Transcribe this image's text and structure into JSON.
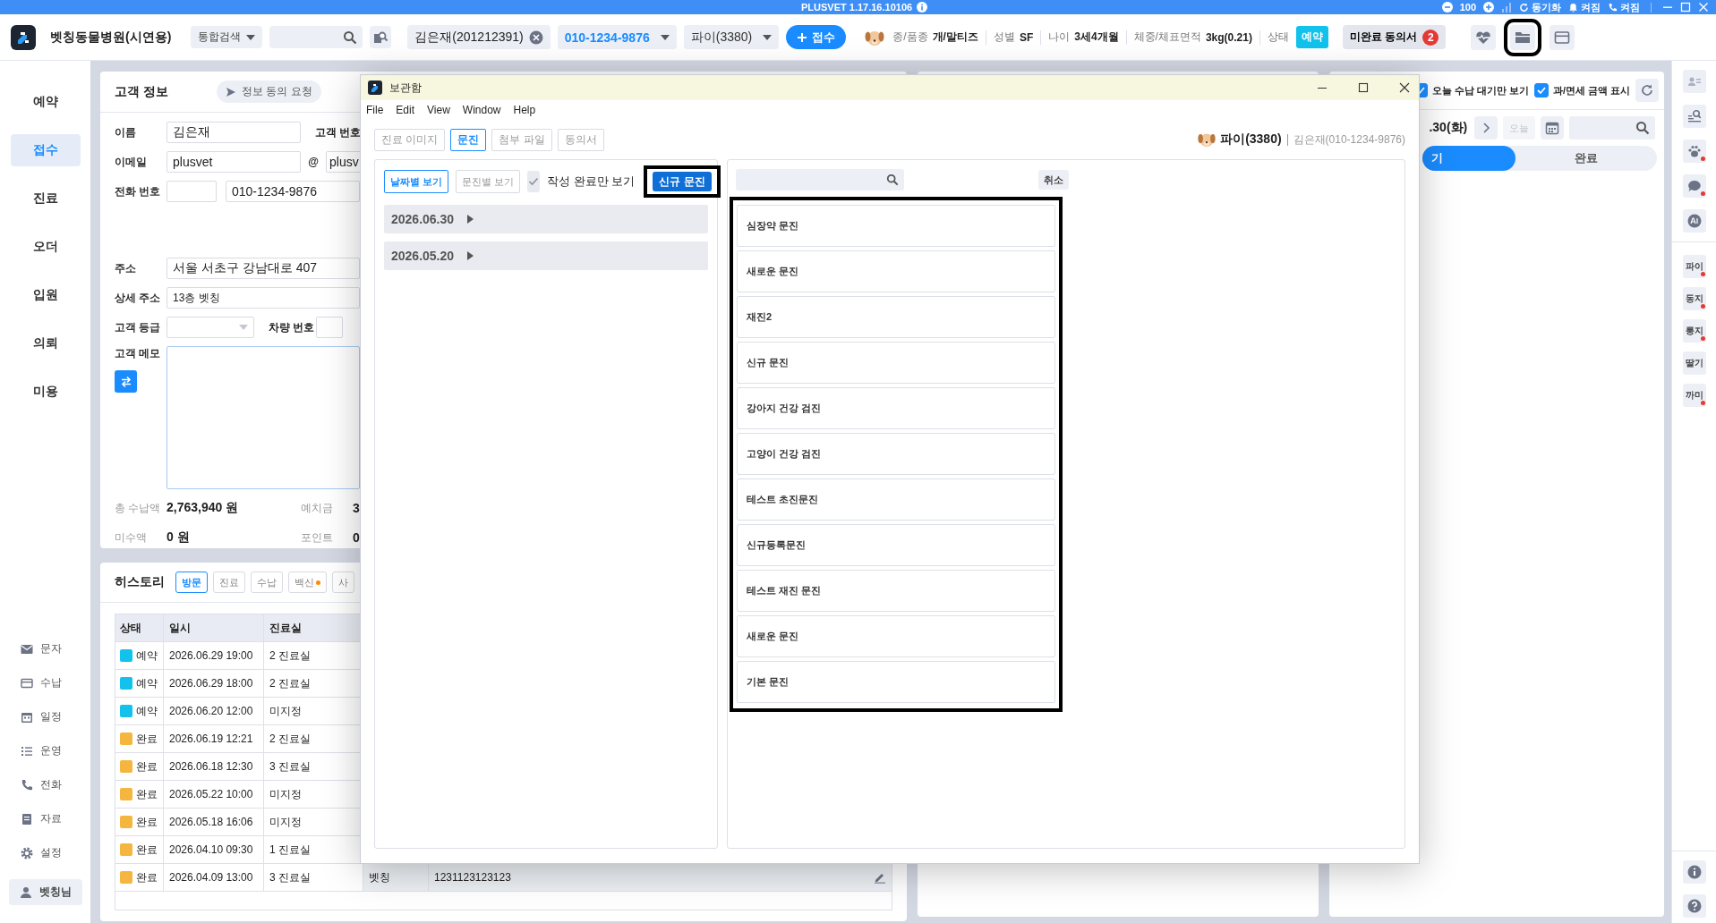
{
  "app_bar": {
    "title": "PLUSVET 1.17.16.10106",
    "zoom": "100",
    "sync": "동기화",
    "alarm": "켜짐",
    "phone": "켜짐"
  },
  "header": {
    "clinic": "벳칭동물병원(시연용)",
    "search_scope": "통합검색",
    "customer_chip": "김은재(201212391)",
    "phone": "010-1234-9876",
    "pet": "파이(3380)",
    "register_button": "접수",
    "pet_info": [
      {
        "label": "종/품종",
        "value": "개/말티즈"
      },
      {
        "label": "성별",
        "value": "SF"
      },
      {
        "label": "나이",
        "value": "3세4개월"
      },
      {
        "label": "체중/체표면적",
        "value": "3kg(0.21)"
      }
    ],
    "status_label": "상태",
    "status": "예약",
    "consent": "미완료 동의서",
    "consent_count": "2"
  },
  "nav": {
    "items": [
      {
        "label": "예약",
        "selected": false
      },
      {
        "label": "접수",
        "selected": true
      },
      {
        "label": "진료",
        "selected": false
      },
      {
        "label": "오더",
        "selected": false
      },
      {
        "label": "입원",
        "selected": false
      },
      {
        "label": "의뢰",
        "selected": false
      },
      {
        "label": "미용",
        "selected": false
      }
    ],
    "tools": [
      "문자",
      "수납",
      "일정",
      "운영",
      "전화",
      "자료",
      "설정"
    ],
    "user": "벳칭님"
  },
  "customer": {
    "title": "고객 정보",
    "consent_button": "정보 동의 요청",
    "name_label": "이름",
    "name": "김은재",
    "number_label": "고객 번호",
    "email_label": "이메일",
    "email_user": "plusvet",
    "at": "@",
    "email_domain": "plusv",
    "phone_label": "전화 번호",
    "phone": "010-1234-9876",
    "address_label": "주소",
    "address": "서울 서초구 강남대로 407",
    "detail_label": "상세 주소",
    "detail": "13층 벳칭",
    "grade_label": "고객 등급",
    "car_label": "차량 번호",
    "memo_label": "고객 메모",
    "total_label": "총 수납액",
    "total": "2,763,940 원",
    "deposit_label": "예치금",
    "deposit": "3",
    "unpaid_label": "미수액",
    "unpaid": "0 원",
    "point_label": "포인트",
    "point": "0"
  },
  "history": {
    "title": "히스토리",
    "tabs": [
      {
        "label": "방문",
        "selected": true,
        "dot": false
      },
      {
        "label": "진료",
        "selected": false,
        "dot": false
      },
      {
        "label": "수납",
        "selected": false,
        "dot": false
      },
      {
        "label": "백신",
        "selected": false,
        "dot": true
      },
      {
        "label": "사",
        "selected": false,
        "dot": false
      }
    ],
    "columns": [
      "상태",
      "일시",
      "진료실"
    ],
    "rows": [
      {
        "status": "예약",
        "color": "#12c2ec",
        "date": "2026.06.29 19:00",
        "room": "2 진료실"
      },
      {
        "status": "예약",
        "color": "#12c2ec",
        "date": "2026.06.29 18:00",
        "room": "2 진료실"
      },
      {
        "status": "예약",
        "color": "#12c2ec",
        "date": "2026.06.20 12:00",
        "room": "미지정"
      },
      {
        "status": "완료",
        "color": "#f4b63e",
        "date": "2026.06.19 12:21",
        "room": "2 진료실"
      },
      {
        "status": "완료",
        "color": "#f4b63e",
        "date": "2026.06.18 12:30",
        "room": "3 진료실"
      },
      {
        "status": "완료",
        "color": "#f4b63e",
        "date": "2026.05.22 10:00",
        "room": "미지정"
      },
      {
        "status": "완료",
        "color": "#f4b63e",
        "date": "2026.05.18 16:06",
        "room": "미지정"
      },
      {
        "status": "완료",
        "color": "#f4b63e",
        "date": "2026.04.10 09:30",
        "room": "1 진료실"
      },
      {
        "status": "완료",
        "color": "#f4b63e",
        "date": "2026.04.09 13:00",
        "room": "3 진료실",
        "staff": "벳칭",
        "memo": "1231123123123"
      }
    ]
  },
  "receipt": {
    "filters": [
      {
        "label": "오늘 수납 대기만 보기",
        "checked": true
      },
      {
        "label": "과/면세 금액 표시",
        "checked": true
      }
    ],
    "date": ".30(화)",
    "today": "오늘",
    "segments": [
      {
        "label": "기",
        "selected": true
      },
      {
        "label": "완료",
        "selected": false
      }
    ]
  },
  "side_strip": {
    "pets": [
      {
        "label": "파이",
        "alert": true
      },
      {
        "label": "동지",
        "alert": true
      },
      {
        "label": "룽지",
        "alert": true
      },
      {
        "label": "딸기",
        "alert": false
      },
      {
        "label": "까미",
        "alert": true
      }
    ]
  },
  "storage_window": {
    "title": "보관함",
    "menu": [
      "File",
      "Edit",
      "View",
      "Window",
      "Help"
    ],
    "tabs": [
      {
        "label": "진료 이미지",
        "selected": false
      },
      {
        "label": "문진",
        "selected": true
      },
      {
        "label": "첨부 파일",
        "selected": false
      },
      {
        "label": "동의서",
        "selected": false
      }
    ],
    "pet": "파이(3380)",
    "owner": "김은재(010-1234-9876)",
    "view_buttons": [
      {
        "label": "날짜별 보기",
        "selected": true
      },
      {
        "label": "문진별 보기",
        "selected": false
      }
    ],
    "completed_only": {
      "label": "작성 완료만 보기",
      "checked": false
    },
    "new_button": "신규 문진",
    "dates": [
      {
        "label": "2026.06.30",
        "expanded": false
      },
      {
        "label": "2026.05.20",
        "expanded": false
      }
    ],
    "cancel_button": "취소",
    "templates": [
      "심장약 문진",
      "새로운 문진",
      "재진2",
      "신규 문진",
      "강아지 건강 검진",
      "고양이 건강 검진",
      "테스트 초진문진",
      "신규등록문진",
      "테스트 재진 문진",
      "새로운 문진",
      "기본 문진"
    ]
  }
}
